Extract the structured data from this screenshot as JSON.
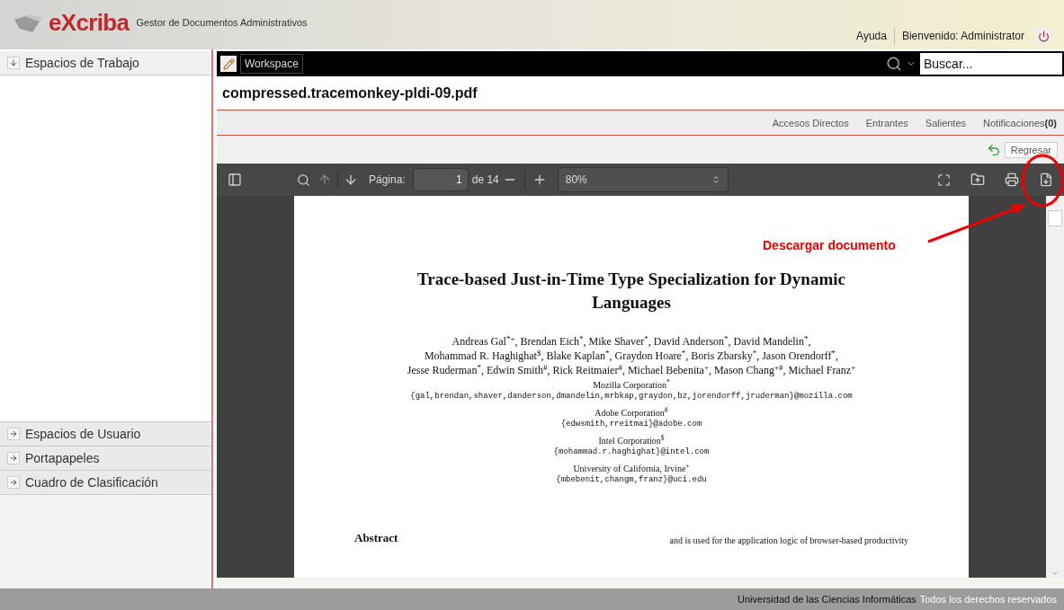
{
  "header": {
    "logo_text": "eXcriba",
    "subtitle": "Gestor de Documentos Administrativos",
    "links": [
      "Ayuda",
      "Bienvenido: Administrator"
    ]
  },
  "sidebar": {
    "top_section": {
      "label": "Espacios de Trabajo",
      "expanded": true
    },
    "sections": [
      {
        "label": "Espacios de Usuario",
        "expanded": false
      },
      {
        "label": "Portapapeles",
        "expanded": false
      },
      {
        "label": "Cuadro de Clasificación",
        "expanded": false
      }
    ]
  },
  "workspace_bar": {
    "tab": "Workspace",
    "search": {
      "placeholder": "Buscar..."
    }
  },
  "document": {
    "title": "compressed.tracemonkey-pldi-09.pdf"
  },
  "nav_links": [
    {
      "label": "Accesos Directos"
    },
    {
      "label": "Entrantes"
    },
    {
      "label": "Salientes"
    },
    {
      "label": "Notificaciones",
      "count": "(0)"
    }
  ],
  "back_button": "Regresar",
  "pdf_toolbar": {
    "page_label": "Página:",
    "page": "1",
    "page_total": "de 14",
    "zoom": "80%"
  },
  "paper": {
    "title": "Trace-based Just-in-Time Type Specialization for Dynamic Languages",
    "authors": [
      "Andreas Gal$^{*+}$, Brendan Eich$^{*}$, Mike Shaver$^{*}$, David Anderson$^{*}$, David Mandelin$^{*}$,",
      "Mohammad R. Haghighat$^{$}$, Blake Kaplan$^{*}$, Graydon Hoare$^{*}$, Boris Zbarsky$^{*}$, Jason Orendorff$^{*}$,",
      "Jesse Ruderman$^{*}$, Edwin Smith$^{#}$, Rick Reitmaier$^{#}$, Michael Bebenita$^{+}$, Mason Chang$^{+#}$, Michael Franz$^{+}$"
    ],
    "affiliations": [
      {
        "name": "Mozilla Corporation$^{*}$",
        "email": "{gal,brendan,shaver,danderson,dmandelin,mrbkap,graydon,bz,jorendorff,jruderman}@mozilla.com"
      },
      {
        "name": "Adobe Corporation$^{#}$",
        "email": "{edwsmith,rreitmai}@adobe.com"
      },
      {
        "name": "Intel Corporation$^{$}$",
        "email": "{mohammad.r.haghighat}@intel.com"
      },
      {
        "name": "University of California, Irvine$^{+}$",
        "email": "{mbebenit,changm,franz}@uci.edu"
      }
    ],
    "abstract_heading": "Abstract",
    "body_start": "and is used for the application logic of browser-based productivity"
  },
  "annotation": {
    "text": "Descargar documento"
  },
  "footer": {
    "institution": "Universidad de las Ciencias Informáticas",
    "rights": "Todos los derechos reservados"
  }
}
